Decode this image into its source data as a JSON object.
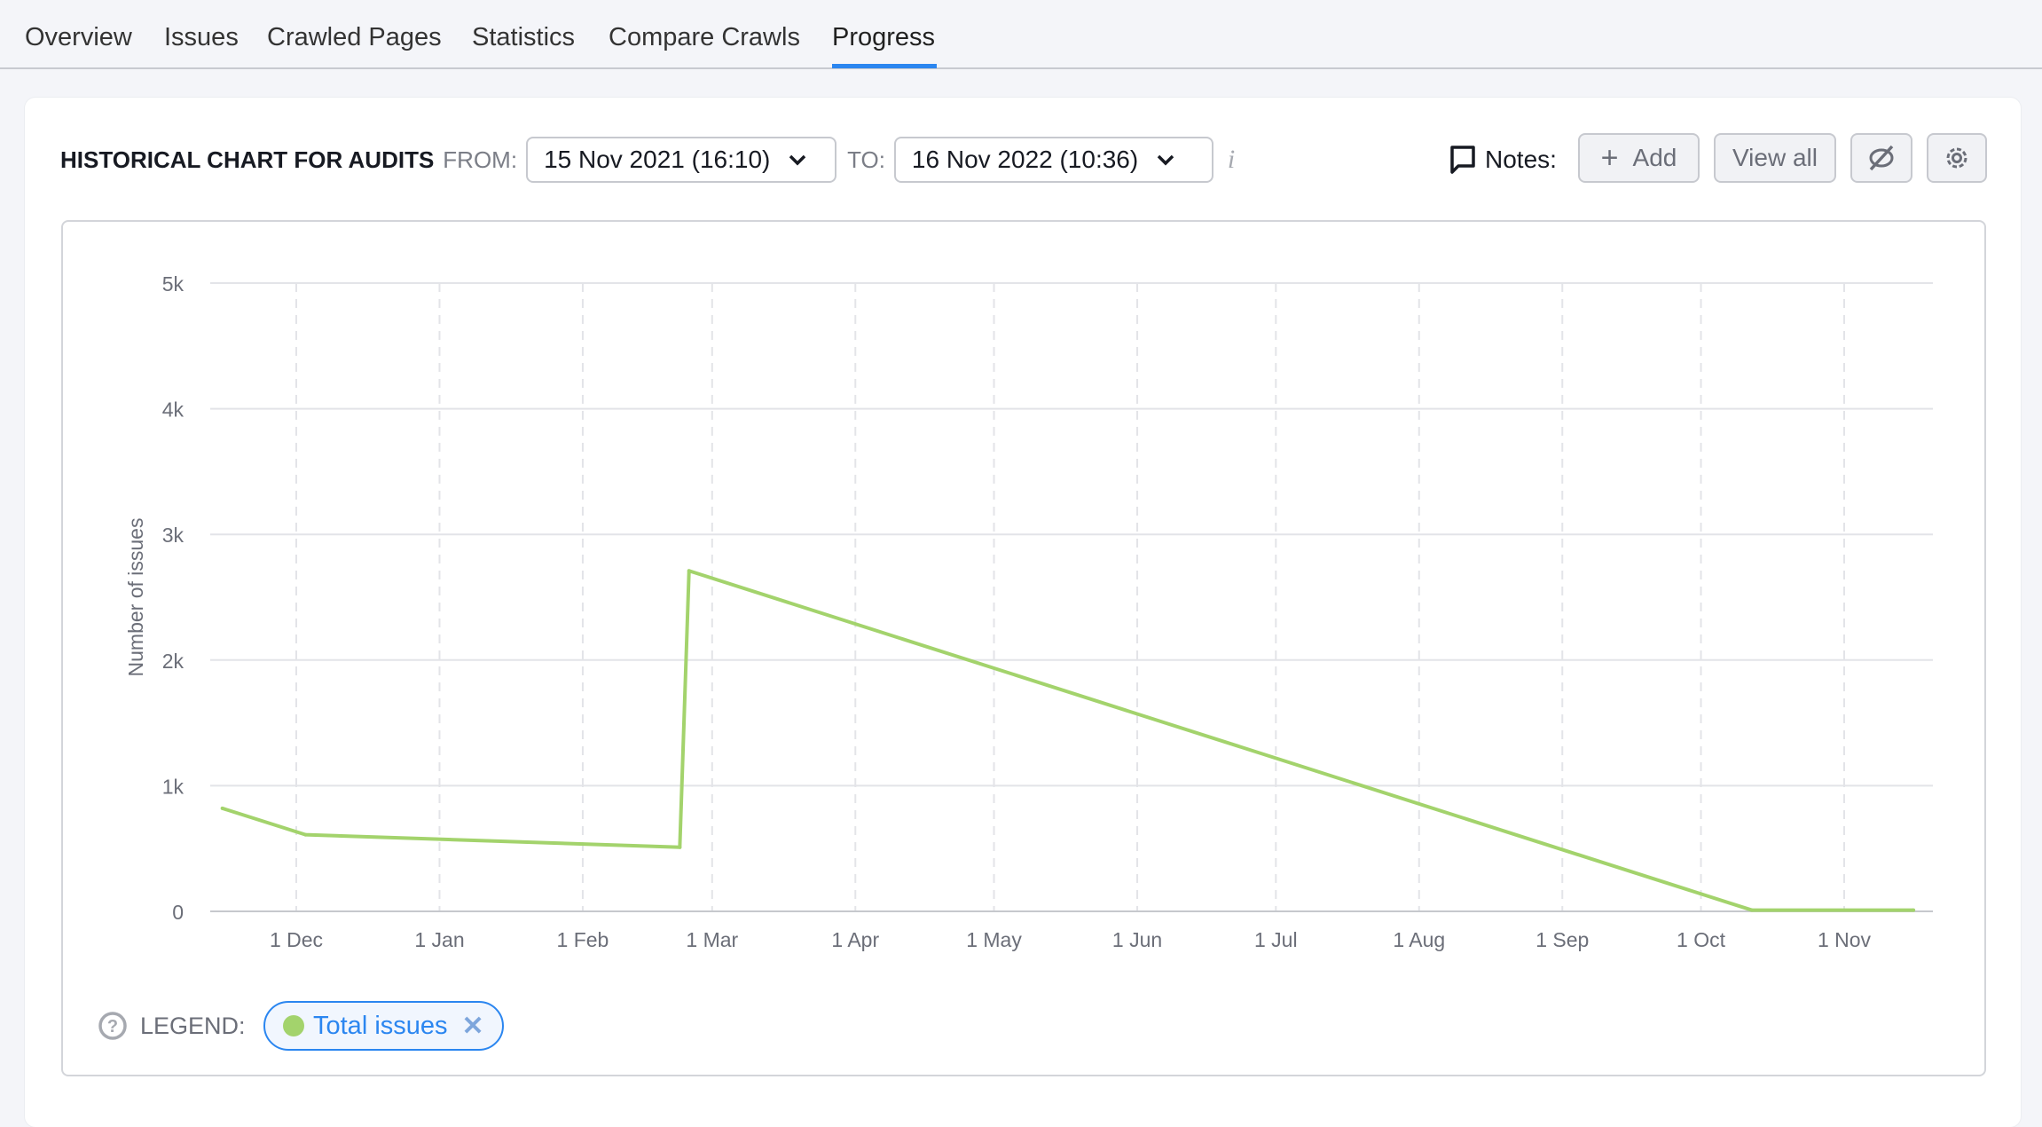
{
  "tabs": [
    {
      "label": "Overview",
      "active": false
    },
    {
      "label": "Issues",
      "active": false
    },
    {
      "label": "Crawled Pages",
      "active": false
    },
    {
      "label": "Statistics",
      "active": false
    },
    {
      "label": "Compare Crawls",
      "active": false
    },
    {
      "label": "Progress",
      "active": true
    }
  ],
  "header": {
    "title": "HISTORICAL CHART FOR AUDITS",
    "from_label": "FROM:",
    "from_value": "15 Nov 2021 (16:10)",
    "to_label": "TO:",
    "to_value": "16 Nov 2022 (10:36)",
    "info_icon": "i",
    "notes_label": "Notes:",
    "add_label": "Add",
    "view_all_label": "View all"
  },
  "legend": {
    "label": "LEGEND:",
    "items": [
      {
        "label": "Total issues",
        "color": "#a3d36c"
      }
    ]
  },
  "colors": {
    "accent": "#2b86f0",
    "series": "#a3d36c"
  },
  "chart_data": {
    "type": "line",
    "ylabel": "Number of issues",
    "xlabel": "",
    "ylim": [
      0,
      5000
    ],
    "y_ticks": [
      "0",
      "1k",
      "2k",
      "3k",
      "4k",
      "5k"
    ],
    "y_tick_values": [
      0,
      1000,
      2000,
      3000,
      4000,
      5000
    ],
    "x_ticks": [
      "1 Dec",
      "1 Jan",
      "1 Feb",
      "1 Mar",
      "1 Apr",
      "1 May",
      "1 Jun",
      "1 Jul",
      "1 Aug",
      "1 Sep",
      "1 Oct",
      "1 Nov"
    ],
    "x_tick_dates": [
      "2021-12-01",
      "2022-01-01",
      "2022-02-01",
      "2022-03-01",
      "2022-04-01",
      "2022-05-01",
      "2022-06-01",
      "2022-07-01",
      "2022-08-01",
      "2022-09-01",
      "2022-10-01",
      "2022-11-01"
    ],
    "grid": true,
    "legend_position": "bottom-left",
    "series": [
      {
        "name": "Total issues",
        "color": "#a3d36c",
        "x": [
          "2021-11-15",
          "2021-12-03",
          "2022-02-22",
          "2022-02-24",
          "2022-10-12",
          "2022-11-16"
        ],
        "y": [
          820,
          610,
          510,
          2710,
          10,
          10
        ]
      }
    ]
  }
}
